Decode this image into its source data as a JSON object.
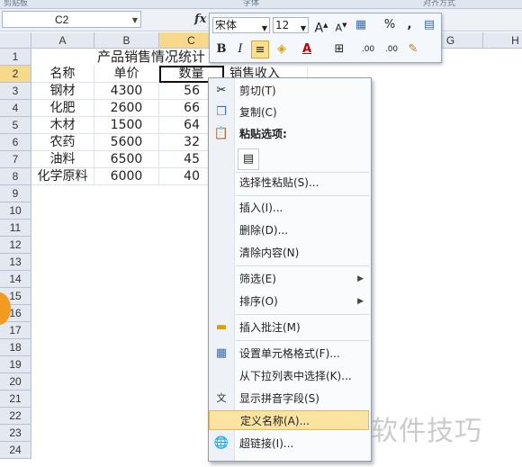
{
  "ribbon": {
    "group_left": "剪贴板",
    "group_mid": "字体",
    "group_right": "对齐方式"
  },
  "formula_bar": {
    "name_box": "C2",
    "fx": "fx"
  },
  "columns": [
    "A",
    "B",
    "C",
    "D",
    "E",
    "F",
    "G",
    "H"
  ],
  "rows": [
    "1",
    "2",
    "3",
    "4",
    "5",
    "6",
    "7",
    "8",
    "9",
    "10",
    "11",
    "12",
    "13",
    "14",
    "15",
    "16",
    "17",
    "18",
    "19",
    "20",
    "21",
    "22",
    "23",
    "24"
  ],
  "sheet": {
    "title": "产品销售情况统计",
    "headers": {
      "a": "名称",
      "b": "单价",
      "c": "数量",
      "d": "销售收入"
    },
    "data": [
      {
        "name": "钢材",
        "price": "4300",
        "qty": "56"
      },
      {
        "name": "化肥",
        "price": "2600",
        "qty": "66"
      },
      {
        "name": "木材",
        "price": "1500",
        "qty": "64"
      },
      {
        "name": "农药",
        "price": "5600",
        "qty": "32"
      },
      {
        "name": "油料",
        "price": "6500",
        "qty": "45"
      },
      {
        "name": "化学原料",
        "price": "6000",
        "qty": "40"
      }
    ]
  },
  "mini_toolbar": {
    "font": "宋体",
    "size": "12",
    "grow": "A",
    "shrink": "A",
    "currency": "%",
    "comma": ",",
    "bold": "B",
    "italic": "I",
    "font_color": "A",
    "dec_inc": ".00",
    "dec_dec": ".00"
  },
  "context_menu": {
    "cut": "剪切(T)",
    "copy": "复制(C)",
    "paste_options": "粘贴选项:",
    "paste_special": "选择性粘贴(S)...",
    "insert": "插入(I)...",
    "delete": "删除(D)...",
    "clear": "清除内容(N)",
    "filter": "筛选(E)",
    "sort": "排序(O)",
    "insert_comment": "插入批注(M)",
    "format_cells": "设置单元格格式(F)...",
    "pick_list": "从下拉列表中选择(K)...",
    "phonetic": "显示拼音字段(S)",
    "define_name": "定义名称(A)...",
    "hyperlink": "超链接(I)..."
  },
  "watermark": "软件技巧",
  "colors": {
    "accent_highlight": "#fbe3a1",
    "selection_header": "#f8d98c"
  }
}
